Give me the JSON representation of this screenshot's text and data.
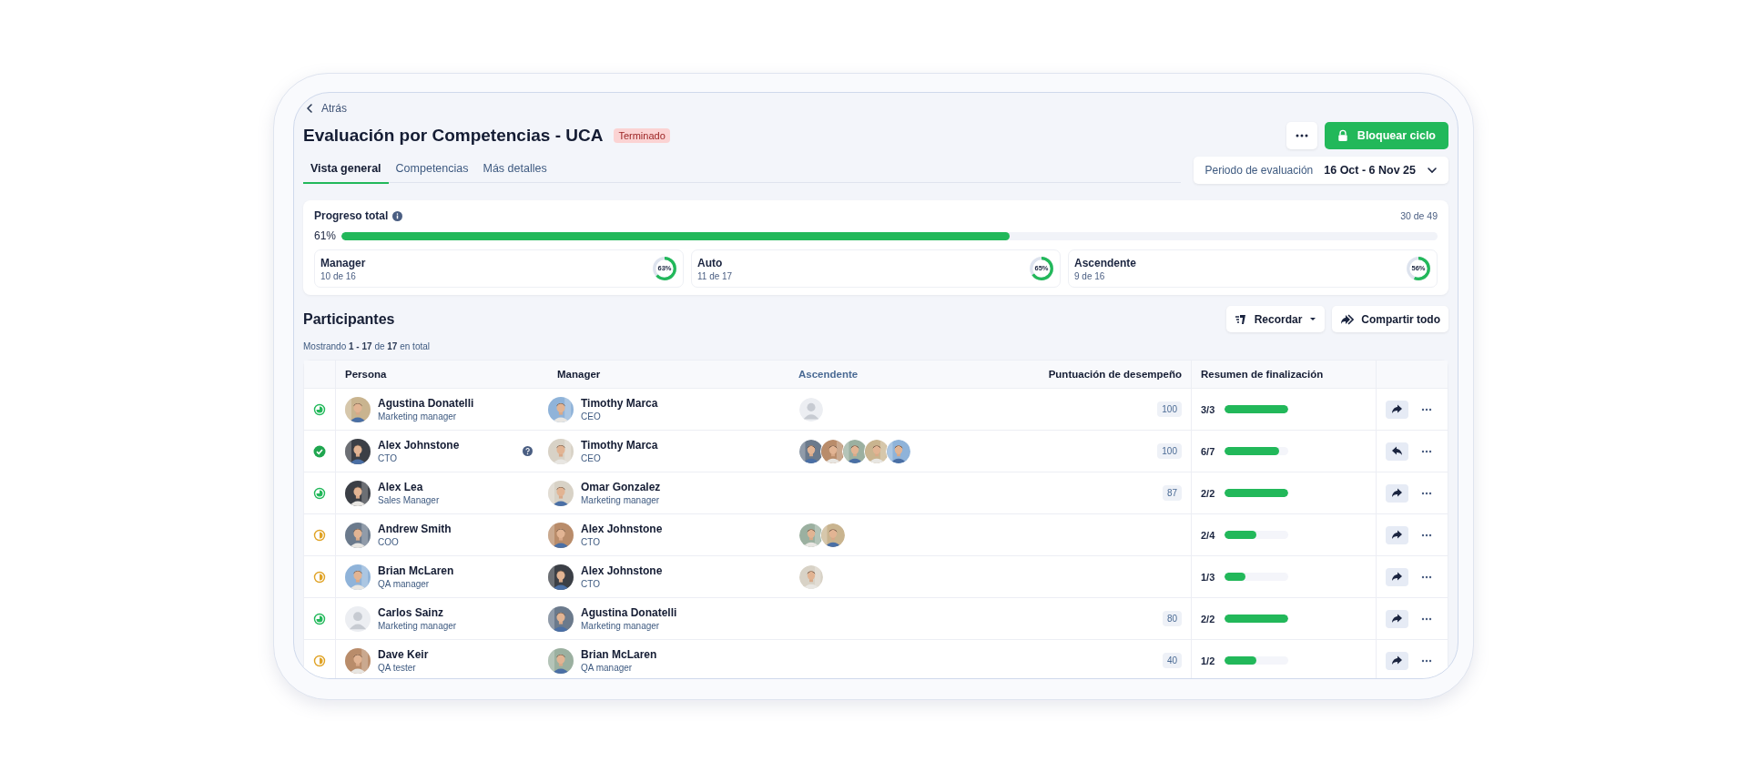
{
  "back_link": {
    "label": "Atrás"
  },
  "header": {
    "title": "Evaluación por Competencias - UCA",
    "status_badge": "Terminado"
  },
  "actions": {
    "primary": "Bloquear ciclo"
  },
  "tabs": [
    {
      "label": "Vista general",
      "selected": true
    },
    {
      "label": "Competencias",
      "selected": false
    },
    {
      "label": "Más detalles",
      "selected": false
    }
  ],
  "period": {
    "label": "Periodo de evaluación",
    "value": "16 Oct - 6 Nov 25"
  },
  "progress": {
    "title": "Progreso total",
    "count": "30 de 49",
    "percent": "61%",
    "level": 0.61,
    "groups": [
      {
        "name": "Manager",
        "count": "10 de 16",
        "percent": "63%"
      },
      {
        "name": "Auto",
        "count": "11 de 17",
        "percent": "65%"
      },
      {
        "name": "Ascendente",
        "count": "9 de 16",
        "percent": "56%"
      }
    ]
  },
  "participants": {
    "title": "Participantes",
    "summary": "Mostrando **1 - 17** de **17** en total",
    "remind_button": "Recordar",
    "share_button": "Compartir todo"
  },
  "table": {
    "columns": [
      {
        "label": "Persona",
        "active": false
      },
      {
        "label": "Manager",
        "active": false
      },
      {
        "label": "Ascendente",
        "active": true
      },
      {
        "label": "Puntuación de desempeño",
        "active": false
      },
      {
        "label": "Resumen de finalización",
        "active": false
      }
    ],
    "rows": [
      {
        "status": {
          "kind": "partial"
        },
        "person": {
          "name": "Agustina Donatelli",
          "role": "Marketing manager",
          "avatar": {
            "kind": "picture"
          },
          "help": false
        },
        "manager": {
          "name": "Timothy Marca",
          "role": "CEO",
          "avatar": {
            "kind": "picture"
          }
        },
        "upward": [
          {
            "kind": "silhouette"
          }
        ],
        "score": "100",
        "completion": "3/3",
        "level": 1,
        "action": {
          "kind": "forward"
        }
      },
      {
        "status": {
          "kind": "complete"
        },
        "person": {
          "name": "Alex Johnstone",
          "role": "CTO",
          "avatar": {
            "kind": "picture"
          },
          "help": true
        },
        "manager": {
          "name": "Timothy Marca",
          "role": "CEO",
          "avatar": {
            "kind": "picture"
          }
        },
        "upward": [
          {
            "kind": "picture"
          },
          {
            "kind": "picture"
          },
          {
            "kind": "picture"
          },
          {
            "kind": "picture"
          },
          {
            "kind": "picture"
          }
        ],
        "score": "100",
        "completion": "6/7",
        "level": 0.857,
        "action": {
          "kind": "back"
        }
      },
      {
        "status": {
          "kind": "partial"
        },
        "person": {
          "name": "Alex Lea",
          "role": "Sales Manager",
          "avatar": {
            "kind": "picture"
          },
          "help": false
        },
        "manager": {
          "name": "Omar Gonzalez",
          "role": "Marketing manager",
          "avatar": {
            "kind": "picture"
          }
        },
        "score": "87",
        "completion": "2/2",
        "level": 1,
        "action": {
          "kind": "forward"
        }
      },
      {
        "status": {
          "kind": "pending"
        },
        "person": {
          "name": "Andrew Smith",
          "role": "COO",
          "avatar": {
            "kind": "picture"
          },
          "help": false
        },
        "manager": {
          "name": "Alex Johnstone",
          "role": "CTO",
          "avatar": {
            "kind": "picture"
          }
        },
        "upward": [
          {
            "kind": "picture"
          },
          {
            "kind": "picture"
          }
        ],
        "completion": "2/4",
        "level": 0.5,
        "action": {
          "kind": "forward"
        }
      },
      {
        "status": {
          "kind": "pending"
        },
        "person": {
          "name": "Brian McLaren",
          "role": "QA manager",
          "avatar": {
            "kind": "picture"
          },
          "help": false
        },
        "manager": {
          "name": "Alex Johnstone",
          "role": "CTO",
          "avatar": {
            "kind": "picture"
          }
        },
        "upward": [
          {
            "kind": "picture"
          }
        ],
        "completion": "1/3",
        "level": 0.333,
        "action": {
          "kind": "forward"
        }
      },
      {
        "status": {
          "kind": "partial"
        },
        "person": {
          "name": "Carlos Sainz",
          "role": "Marketing manager",
          "avatar": {
            "kind": "silhouette"
          },
          "help": false
        },
        "manager": {
          "name": "Agustina Donatelli",
          "role": "Marketing manager",
          "avatar": {
            "kind": "picture"
          }
        },
        "score": "80",
        "completion": "2/2",
        "level": 1,
        "action": {
          "kind": "forward"
        }
      },
      {
        "status": {
          "kind": "pending"
        },
        "person": {
          "name": "Dave Keir",
          "role": "QA tester",
          "avatar": {
            "kind": "picture"
          },
          "help": false
        },
        "manager": {
          "name": "Brian McLaren",
          "role": "QA manager",
          "avatar": {
            "kind": "picture"
          }
        },
        "score": "40",
        "completion": "1/2",
        "level": 0.5,
        "action": {
          "kind": "forward"
        }
      }
    ]
  }
}
